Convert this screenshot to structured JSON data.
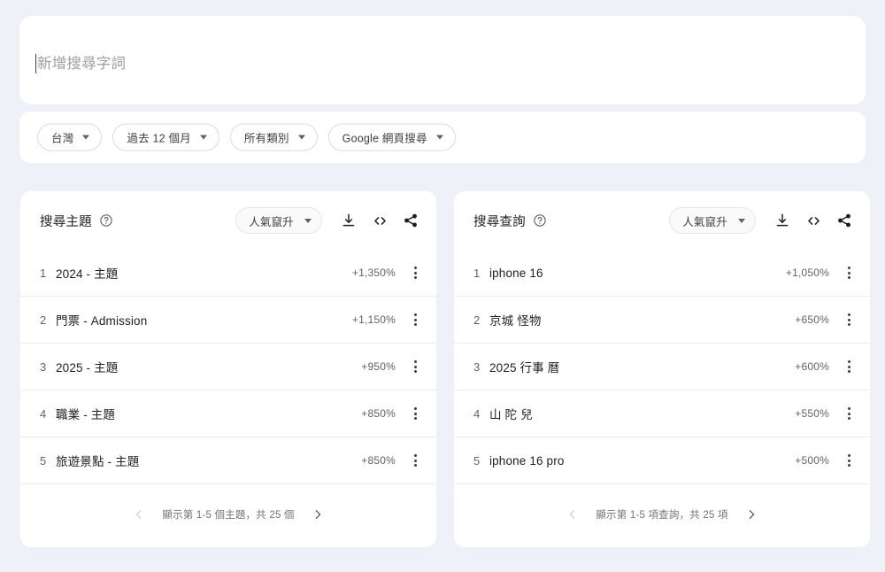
{
  "search": {
    "placeholder": "新增搜尋字詞",
    "value": ""
  },
  "filters": [
    {
      "label": "台灣",
      "icon": "chevron-down-icon"
    },
    {
      "label": "過去 12 個月",
      "icon": "chevron-down-icon"
    },
    {
      "label": "所有類別",
      "icon": "chevron-down-icon"
    },
    {
      "label": "Google 網頁搜尋",
      "icon": "chevron-down-icon"
    }
  ],
  "panels": [
    {
      "title": "搜尋主題",
      "help_icon": "help-circle-icon",
      "sort": {
        "label": "人氣竄升",
        "icon": "chevron-down-icon"
      },
      "actions": [
        {
          "name": "download-icon",
          "title": "下載"
        },
        {
          "name": "embed-code-icon",
          "title": "嵌入"
        },
        {
          "name": "share-icon",
          "title": "分享"
        }
      ],
      "rows": [
        {
          "rank": "1",
          "label": "2024 - 主題",
          "value": "+1,350%"
        },
        {
          "rank": "2",
          "label": "門票 - Admission",
          "value": "+1,150%"
        },
        {
          "rank": "3",
          "label": "2025 - 主題",
          "value": "+950%"
        },
        {
          "rank": "4",
          "label": "職業 - 主題",
          "value": "+850%"
        },
        {
          "rank": "5",
          "label": "旅遊景點 - 主題",
          "value": "+850%"
        }
      ],
      "footer": {
        "prev_icon": "chevron-left-icon",
        "text": "顯示第 1-5 個主題，共 25 個",
        "next_icon": "chevron-right-icon"
      }
    },
    {
      "title": "搜尋查詢",
      "help_icon": "help-circle-icon",
      "sort": {
        "label": "人氣竄升",
        "icon": "chevron-down-icon"
      },
      "actions": [
        {
          "name": "download-icon",
          "title": "下載"
        },
        {
          "name": "embed-code-icon",
          "title": "嵌入"
        },
        {
          "name": "share-icon",
          "title": "分享"
        }
      ],
      "rows": [
        {
          "rank": "1",
          "label": "iphone 16",
          "value": "+1,050%"
        },
        {
          "rank": "2",
          "label": "京城 怪物",
          "value": "+650%"
        },
        {
          "rank": "3",
          "label": "2025 行事 曆",
          "value": "+600%"
        },
        {
          "rank": "4",
          "label": "山 陀 兒",
          "value": "+550%"
        },
        {
          "rank": "5",
          "label": "iphone 16 pro",
          "value": "+500%"
        }
      ],
      "footer": {
        "prev_icon": "chevron-left-icon",
        "text": "顯示第 1-5 項查詢，共 25 項",
        "next_icon": "chevron-right-icon"
      }
    }
  ],
  "colors": {
    "page_background": "#eef1f7",
    "card_background": "#ffffff",
    "text_primary": "#202124",
    "text_secondary": "#5f6368",
    "placeholder": "#9aa0a6",
    "divider": "#ececec"
  }
}
